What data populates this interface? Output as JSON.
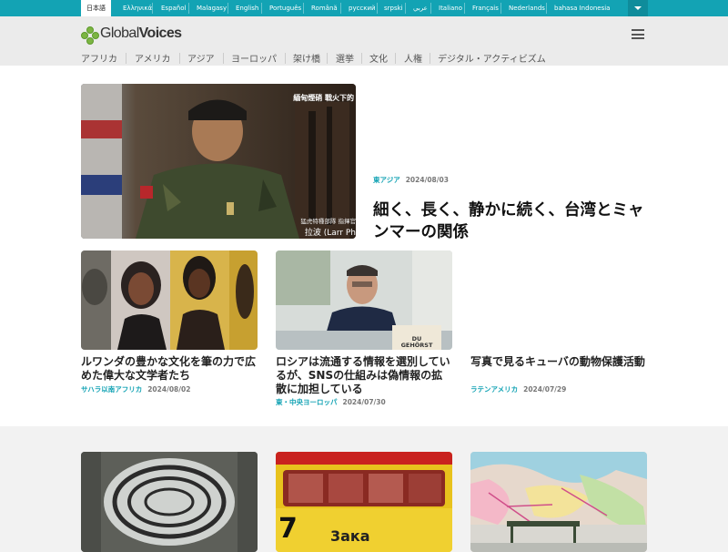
{
  "language_bar": {
    "active": "日本語",
    "languages": [
      "Ελληνικά",
      "Español",
      "Malagasy",
      "English",
      "Português",
      "Română",
      "русский",
      "srpski",
      "عربي",
      "Italiano",
      "Français",
      "Nederlands",
      "bahasa Indonesia"
    ]
  },
  "header": {
    "logo_light": "Global",
    "logo_bold": "Voices",
    "nav": [
      "アフリカ",
      "アメリカ",
      "アジア",
      "ヨーロッパ",
      "架け橋",
      "選挙",
      "文化",
      "人権",
      "デジタル・アクティビズム"
    ]
  },
  "featured": {
    "title": "細く、長く、静かに続く、台湾とミャンマーの関係",
    "category": "東アジア",
    "date": "2024/08/03",
    "image_overlay_top": "緬甸煙硝 戰火下的",
    "image_overlay_sub": "猛虎特種部隊 指揮官",
    "image_overlay_name": "拉波 (Larr Ph"
  },
  "articles": [
    {
      "title": "ルワンダの豊かな文化を筆の力で広めた偉大な文学者たち",
      "category": "サハラ以南アフリカ",
      "date": "2024/08/02"
    },
    {
      "title": "ロシアは流通する情報を選別しているが、SNSの仕組みは偽情報の拡散に加担している",
      "category": "東・中央ヨーロッパ",
      "date": "2024/07/30",
      "book_text": "DU GEHÖRST"
    },
    {
      "title": "写真で見るキューバの動物保護活動",
      "category": "ラテンアメリカ",
      "date": "2024/07/29"
    }
  ],
  "lower_cards": [
    {
      "alt": "mural"
    },
    {
      "alt": "tram",
      "overlay_digit": "7",
      "overlay_text": "3ака"
    },
    {
      "alt": "map"
    }
  ],
  "colors": {
    "accent": "#13a3b4",
    "logo_green": "#7cb542"
  }
}
